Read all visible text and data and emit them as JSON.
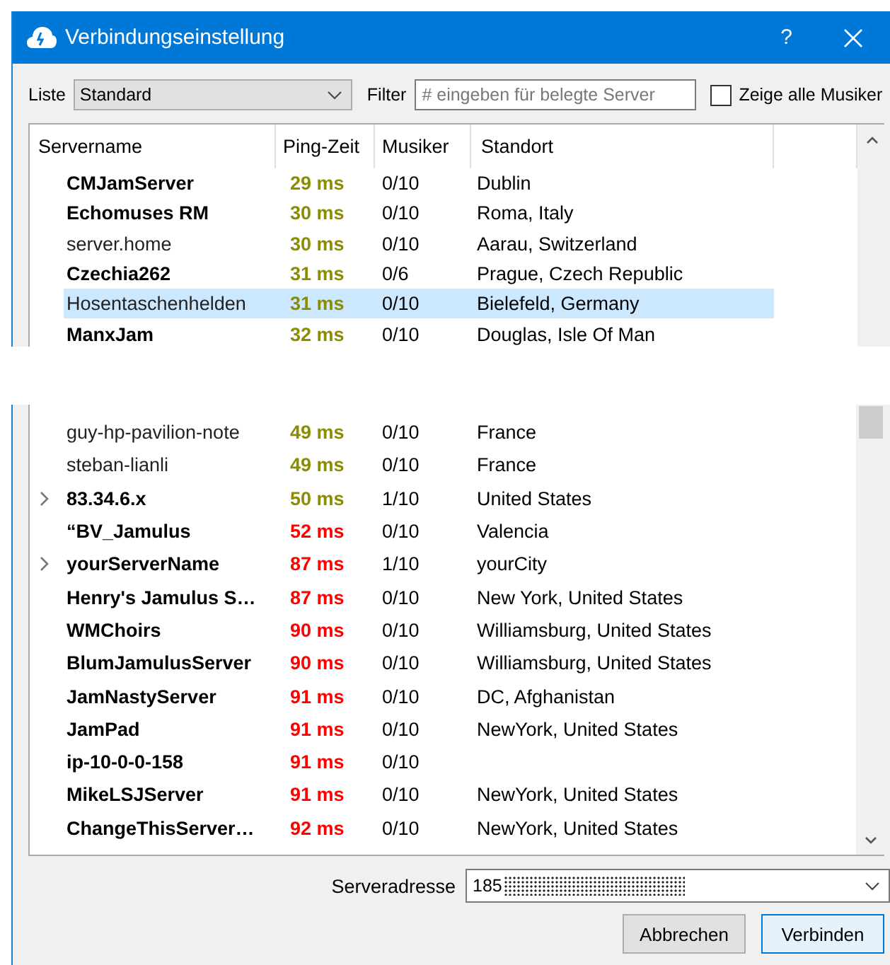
{
  "window": {
    "title": "Verbindungseinstellung",
    "help": "?"
  },
  "controls": {
    "list_label": "Liste",
    "list_value": "Standard",
    "filter_label": "Filter",
    "filter_placeholder": "# eingeben für belegte Server",
    "show_all": {
      "label": "Zeige alle Musiker",
      "checked": false
    }
  },
  "table": {
    "columns": [
      "Servername",
      "Ping-Zeit",
      "Musiker",
      "Standort"
    ],
    "rows": [
      {
        "name": "CMJamServer",
        "ping": "29 ms",
        "color": "#8c8c00",
        "musicians": "0/10",
        "location": "Dublin",
        "bold": true,
        "expandable": false,
        "selected": false
      },
      {
        "name": "Echomuses RM",
        "ping": "30 ms",
        "color": "#8c8c00",
        "musicians": "0/10",
        "location": "Roma, Italy",
        "bold": true,
        "expandable": false,
        "selected": false
      },
      {
        "name": "server.home",
        "ping": "30 ms",
        "color": "#8c8c00",
        "musicians": "0/10",
        "location": "Aarau, Switzerland",
        "bold": false,
        "expandable": false,
        "selected": false
      },
      {
        "name": "Czechia262",
        "ping": "31 ms",
        "color": "#8c8c00",
        "musicians": "0/6",
        "location": "Prague, Czech Republic",
        "bold": true,
        "expandable": false,
        "selected": false
      },
      {
        "name": "Hosentaschenhelden",
        "ping": "31 ms",
        "color": "#8c8c00",
        "musicians": "0/10",
        "location": "Bielefeld, Germany",
        "bold": false,
        "expandable": false,
        "selected": true
      },
      {
        "name": "ManxJam",
        "ping": "32 ms",
        "color": "#8c8c00",
        "musicians": "0/10",
        "location": "Douglas, Isle Of Man",
        "bold": true,
        "expandable": false,
        "selected": false
      }
    ],
    "rows_continued": [
      {
        "name": "guy-hp-pavilion-note",
        "ping": "49 ms",
        "color": "#8c8c00",
        "musicians": "0/10",
        "location": "France",
        "bold": false,
        "expandable": false,
        "selected": false
      },
      {
        "name": "steban-lianli",
        "ping": "49 ms",
        "color": "#8c8c00",
        "musicians": "0/10",
        "location": "France",
        "bold": false,
        "expandable": false,
        "selected": false
      },
      {
        "name": "83.34.6.x",
        "ping": "50 ms",
        "color": "#8c8c00",
        "musicians": "1/10",
        "location": "United States",
        "bold": true,
        "expandable": true,
        "selected": false
      },
      {
        "name": "“BV_Jamulus",
        "ping": "52 ms",
        "color": "#ff0000",
        "musicians": "0/10",
        "location": "Valencia",
        "bold": true,
        "expandable": false,
        "selected": false
      },
      {
        "name": "yourServerName",
        "ping": "87 ms",
        "color": "#ff0000",
        "musicians": "1/10",
        "location": "yourCity",
        "bold": true,
        "expandable": true,
        "selected": false
      },
      {
        "name": "Henry's Jamulus S…",
        "ping": "87 ms",
        "color": "#ff0000",
        "musicians": "0/10",
        "location": "New York, United States",
        "bold": true,
        "expandable": false,
        "selected": false
      },
      {
        "name": "WMChoirs",
        "ping": "90 ms",
        "color": "#ff0000",
        "musicians": "0/10",
        "location": "Williamsburg, United States",
        "bold": true,
        "expandable": false,
        "selected": false
      },
      {
        "name": "BlumJamulusServer",
        "ping": "90 ms",
        "color": "#ff0000",
        "musicians": "0/10",
        "location": "Williamsburg, United States",
        "bold": true,
        "expandable": false,
        "selected": false
      },
      {
        "name": "JamNastyServer",
        "ping": "91 ms",
        "color": "#ff0000",
        "musicians": "0/10",
        "location": "DC, Afghanistan",
        "bold": true,
        "expandable": false,
        "selected": false
      },
      {
        "name": "JamPad",
        "ping": "91 ms",
        "color": "#ff0000",
        "musicians": "0/10",
        "location": "NewYork, United States",
        "bold": true,
        "expandable": false,
        "selected": false
      },
      {
        "name": "ip-10-0-0-158",
        "ping": "91 ms",
        "color": "#ff0000",
        "musicians": "0/10",
        "bold": true,
        "expandable": false,
        "selected": false
      },
      {
        "name": "MikeLSJServer",
        "ping": "91 ms",
        "color": "#ff0000",
        "musicians": "0/10",
        "location": "NewYork, United States",
        "bold": true,
        "expandable": false,
        "selected": false
      },
      {
        "name": "ChangeThisServer…",
        "ping": "92 ms",
        "color": "#ff0000",
        "musicians": "0/10",
        "location": "NewYork, United States",
        "bold": true,
        "expandable": false,
        "selected": false
      }
    ]
  },
  "server_address": {
    "label": "Serveradresse",
    "value": "185",
    "redacted": true
  },
  "buttons": [
    {
      "label": "Abbrechen",
      "default": false
    },
    {
      "label": "Verbinden",
      "default": true
    }
  ]
}
